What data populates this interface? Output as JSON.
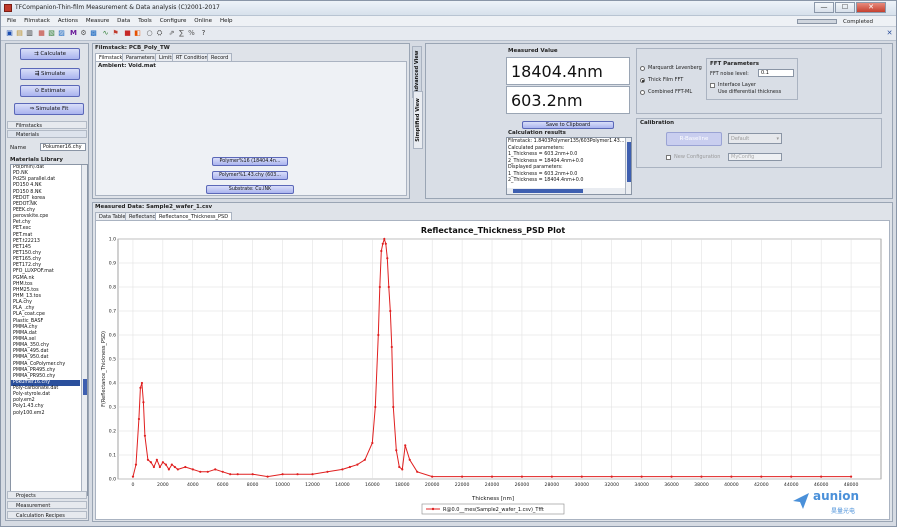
{
  "window": {
    "title": "TFCompanion-Thin-film Measurement & Data analysis (C)2001-2017",
    "minimize": "—",
    "maximize": "☐",
    "close": "✕"
  },
  "menu": [
    "File",
    "Filmstack",
    "Actions",
    "Measure",
    "Data",
    "Tools",
    "Configure",
    "Online",
    "Help"
  ],
  "status": {
    "text": "Completed",
    "progress": 1.0
  },
  "left": {
    "calculate": "Calculate",
    "simulate": "Simulate",
    "estimate": "Estimate",
    "simulate_fit": "Simulate Fit",
    "filmstacks": "Filmstacks",
    "materials": "Materials",
    "name_label": "Name",
    "name_value": "Pokumer16.chy",
    "library_label": "Materials Library",
    "library_items": [
      "Pd(bmih).dat",
      "PD.NK",
      "Pd25i parallel.dat",
      "PD150 4.NK",
      "PD150 8.NK",
      "PEDOT_korea",
      "PEDOT.NK",
      "PEEK.chy",
      "perovskite.cpe",
      "Pet.chy",
      "PET.exc",
      "PET.mat",
      "PET.t22213",
      "PET145",
      "PET150.chy",
      "PET165.chy",
      "PET172.chy",
      "PFO_LUXPOF.mat",
      "PGMA.nk",
      "PHM.tos",
      "PHM25.tos",
      "PHM_13.tos",
      "PLA.chy",
      "PLA_.chy",
      "PLA_coat.cpe",
      "Plastic_BASF",
      "PMMA.chy",
      "PMMA.dat",
      "PMMA.sel",
      "PMMA_350.chy",
      "PMMA_495.dat",
      "PMMA_950.dat",
      "PMMA_CoPolymer.chy",
      "PMMA_PR495.chy",
      "PMMA_PR950.chy",
      "Pokumer16.chy",
      "Poly-carbonate.dat",
      "Poly-styrole.dat",
      "poly.em2",
      "Poly1.43.chy",
      "poly100.em2"
    ],
    "selected_index": 35,
    "projects": "Projects",
    "measurement": "Measurement",
    "calc_recipes": "Calculation Recipes"
  },
  "filmstack": {
    "title": "Filmstack: PCB_Poly_TW",
    "tabs": [
      "Filmstack",
      "Parameters",
      "Limits",
      "RT Conditions",
      "Record"
    ],
    "ambient": "Ambient: Void.mat",
    "layers": [
      "Polymer%16 (18404.4n...",
      "Polymer%1.43.chy (603...",
      "Substrate: Cu.lNK"
    ],
    "advanced_view": "Advanced View",
    "simplified_view": "Simplified View"
  },
  "measured": {
    "label": "Measured Value",
    "value1": "18404.4nm",
    "value2": "603.2nm",
    "save_button": "Save to Clipboard",
    "calc_results_label": "Calculation results",
    "calc_results": [
      "Filmstack: 1.8403Polymer135/603Polymer1.43...",
      "Calculated parameters:",
      "1_Thickness = 603.2nm+0.0",
      "2_Thickness = 18404.4nm+0.0",
      "Displayed parameters:",
      "1_Thickness = 603.2nm+0.0",
      "2_Thickness = 18404.4nm+0.0"
    ]
  },
  "fit": {
    "options": [
      "Marquardt Levenberg",
      "Thick Film FFT",
      "Combined FFT-ML"
    ],
    "selected": 1,
    "fft_params_label": "FFT Parameters",
    "noise_label": "FFT noise level:",
    "noise_value": "0.1",
    "interface_layer": "Interface Layer",
    "use_diff_thickness": "Use differential thickness"
  },
  "calibration": {
    "label": "Calibration",
    "button": "R-Baseline",
    "dropdown": "Default",
    "new_config": "New Configuration",
    "config_placeholder": "MyConfig"
  },
  "measured_data": {
    "title": "Measured Data: Sample2_wafer_1.csv",
    "tabs": [
      "Data Table",
      "Reflectance",
      "Reflectance_Thickness_PSD"
    ]
  },
  "chart_data": {
    "type": "line",
    "title": "Reflectance_Thickness_PSD Plot",
    "xlabel": "Thickness [nm]",
    "ylabel": "F(Reflectance_Thickness_PSD)",
    "xlim": [
      -1000,
      50000
    ],
    "ylim": [
      0,
      1.0
    ],
    "xticks": [
      0,
      2000,
      4000,
      6000,
      8000,
      10000,
      12000,
      14000,
      16000,
      18000,
      20000,
      22000,
      24000,
      26000,
      28000,
      30000,
      32000,
      34000,
      36000,
      38000,
      40000,
      42000,
      44000,
      46000,
      48000
    ],
    "yticks": [
      0.0,
      0.1,
      0.2,
      0.3,
      0.4,
      0.5,
      0.6,
      0.7,
      0.8,
      0.9,
      1.0
    ],
    "grid": true,
    "legend_position": "bottom",
    "series": [
      {
        "name": "R@0.0__mes(Sample2_wafer_1.csv)_Tfft",
        "color": "#e02020",
        "x": [
          0,
          200,
          400,
          500,
          600,
          700,
          800,
          1000,
          1200,
          1400,
          1600,
          1800,
          2000,
          2200,
          2400,
          2600,
          2800,
          3000,
          3500,
          4000,
          4500,
          5000,
          5500,
          6000,
          6500,
          7000,
          8000,
          9000,
          10000,
          11000,
          12000,
          13000,
          14000,
          14500,
          15000,
          15500,
          16000,
          16200,
          16400,
          16500,
          16600,
          16700,
          16800,
          16900,
          17000,
          17100,
          17200,
          17300,
          17400,
          17600,
          17800,
          18000,
          18200,
          18500,
          19000,
          20000,
          22000,
          24000,
          26000,
          28000,
          30000,
          32000,
          34000,
          36000,
          38000,
          40000,
          42000,
          44000,
          46000,
          48000
        ],
        "y": [
          0.01,
          0.06,
          0.25,
          0.38,
          0.4,
          0.32,
          0.18,
          0.08,
          0.07,
          0.05,
          0.08,
          0.05,
          0.07,
          0.06,
          0.04,
          0.06,
          0.05,
          0.04,
          0.05,
          0.04,
          0.03,
          0.03,
          0.04,
          0.03,
          0.02,
          0.02,
          0.02,
          0.01,
          0.02,
          0.02,
          0.02,
          0.03,
          0.04,
          0.05,
          0.06,
          0.08,
          0.15,
          0.3,
          0.6,
          0.8,
          0.95,
          0.98,
          1.0,
          0.98,
          0.92,
          0.8,
          0.7,
          0.55,
          0.3,
          0.12,
          0.05,
          0.04,
          0.14,
          0.08,
          0.03,
          0.01,
          0.01,
          0.01,
          0.01,
          0.01,
          0.01,
          0.01,
          0.01,
          0.01,
          0.01,
          0.01,
          0.01,
          0.01,
          0.01,
          0.01
        ]
      }
    ]
  },
  "watermark": {
    "brand": "aunion",
    "sub": "昊量光电"
  }
}
